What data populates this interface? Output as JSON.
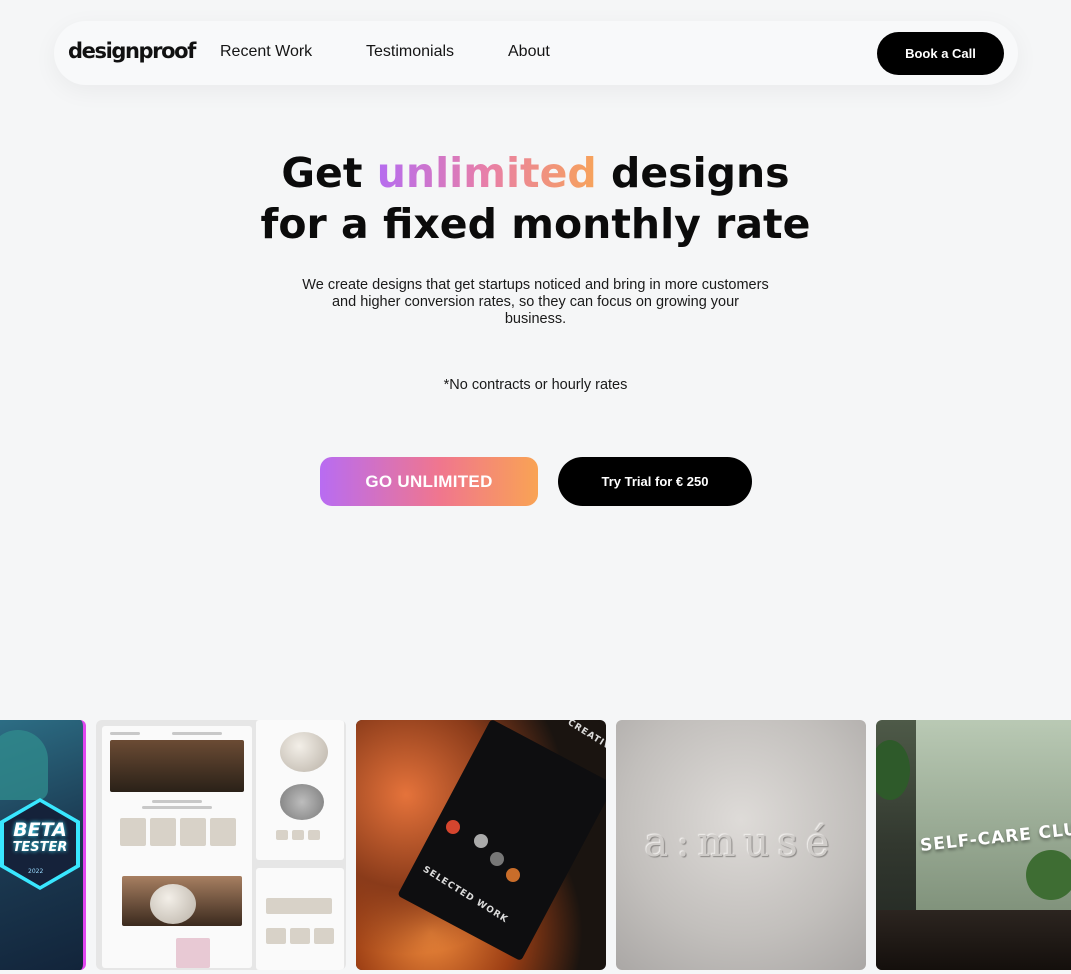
{
  "nav": {
    "logo": "designproof",
    "links": [
      "Recent Work",
      "Testimonials",
      "About"
    ],
    "cta": "Book a Call"
  },
  "hero": {
    "line1_a": "Get",
    "line1_highlight": "unlimited",
    "line1_b": "designs",
    "line2": "for a fixed monthly rate",
    "subtitle": "We create designs that get startups noticed and bring in more customers and higher conversion rates, so they can focus on growing your business.",
    "note": "*No contracts or hourly rates",
    "cta_primary": "GO UNLIMITED",
    "cta_secondary": "Try Trial for € 250"
  },
  "gallery": {
    "cards": [
      {
        "label_main": "BETA",
        "label_sub": "TESTER",
        "year": "2022"
      },
      {},
      {
        "tags": [
          "SELECTED WORK",
          "CREATIVE"
        ]
      },
      {
        "wordmark": "a:musé"
      },
      {
        "title": "SELF-CARE CLUB"
      }
    ]
  },
  "colors": {
    "gradient_start": "#b86cf2",
    "gradient_mid": "#f0768e",
    "gradient_end": "#f9a354",
    "dark": "#000000"
  }
}
